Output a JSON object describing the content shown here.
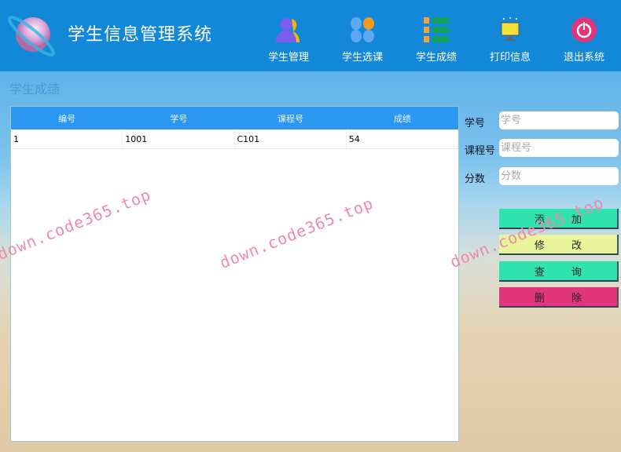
{
  "header": {
    "title": "学生信息管理系统",
    "nav": [
      {
        "label": "学生管理",
        "icon": "users-icon"
      },
      {
        "label": "学生选课",
        "icon": "grid-icon"
      },
      {
        "label": "学生成绩",
        "icon": "list-icon"
      },
      {
        "label": "打印信息",
        "icon": "monitor-icon"
      },
      {
        "label": "退出系统",
        "icon": "power-icon"
      }
    ]
  },
  "page": {
    "title": "学生成绩"
  },
  "table": {
    "columns": [
      "编号",
      "学号",
      "课程号",
      "成绩"
    ],
    "rows": [
      [
        "1",
        "1001",
        "C101",
        "54"
      ]
    ]
  },
  "form": {
    "student_id": {
      "label": "学号",
      "placeholder": "学号",
      "value": ""
    },
    "course_id": {
      "label": "课程号",
      "placeholder": "课程号",
      "value": ""
    },
    "score": {
      "label": "分数",
      "placeholder": "分数",
      "value": ""
    }
  },
  "buttons": {
    "add": "添 加",
    "edit": "修 改",
    "query": "查 询",
    "delete": "删 除"
  },
  "colors": {
    "header": "#1488d8",
    "add": "#2fe3ae",
    "edit": "#e8f59a",
    "query": "#2fe3ae",
    "delete": "#e2367a"
  },
  "watermark": "down.code365.top"
}
